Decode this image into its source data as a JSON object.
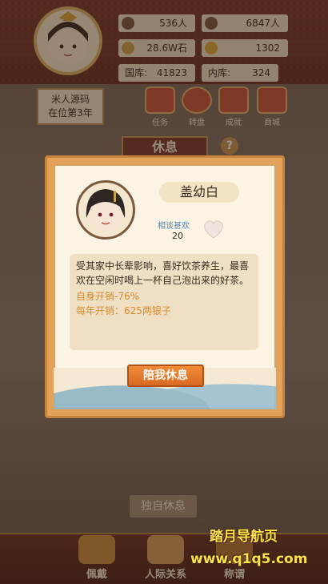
{
  "header": {
    "stats": {
      "population_a": "536人",
      "population_b": "6847人",
      "stone": "28.6W石",
      "gold": "1302",
      "treasury_label": "国库:",
      "treasury_value": "41823",
      "inner_label": "内库:",
      "inner_value": "324"
    },
    "ruler": {
      "line1": "米人源码",
      "line2": "在位第3年"
    },
    "menu": [
      {
        "label": "任务"
      },
      {
        "label": "转盘"
      },
      {
        "label": "成就"
      },
      {
        "label": "商城"
      }
    ]
  },
  "rest_banner": "休息",
  "dialog": {
    "npc_name": "盖幼白",
    "favor_label": "相谈甚欢",
    "favor_value": "20",
    "description": "受其家中长辈影响，喜好饮茶养生，最喜欢在空闲时喝上一杯自己泡出来的好茶。",
    "own_cost": "自身开销-76%",
    "yearly_cost": "每年开销：625两银子",
    "accompany_button": "陪我休息"
  },
  "solo_rest_button": "独自休息",
  "bottom_nav": [
    {
      "label": "佩戴"
    },
    {
      "label": "人际关系"
    },
    {
      "label": "称谓"
    }
  ],
  "watermark": {
    "line1": "踏月导航页",
    "line2": "www.q1q5.com"
  },
  "colors": {
    "dialog_frame": "#e2a25a",
    "accent_button": "#e0772c",
    "cost_text": "#d88a2e",
    "favor_text": "#4a86b8"
  }
}
